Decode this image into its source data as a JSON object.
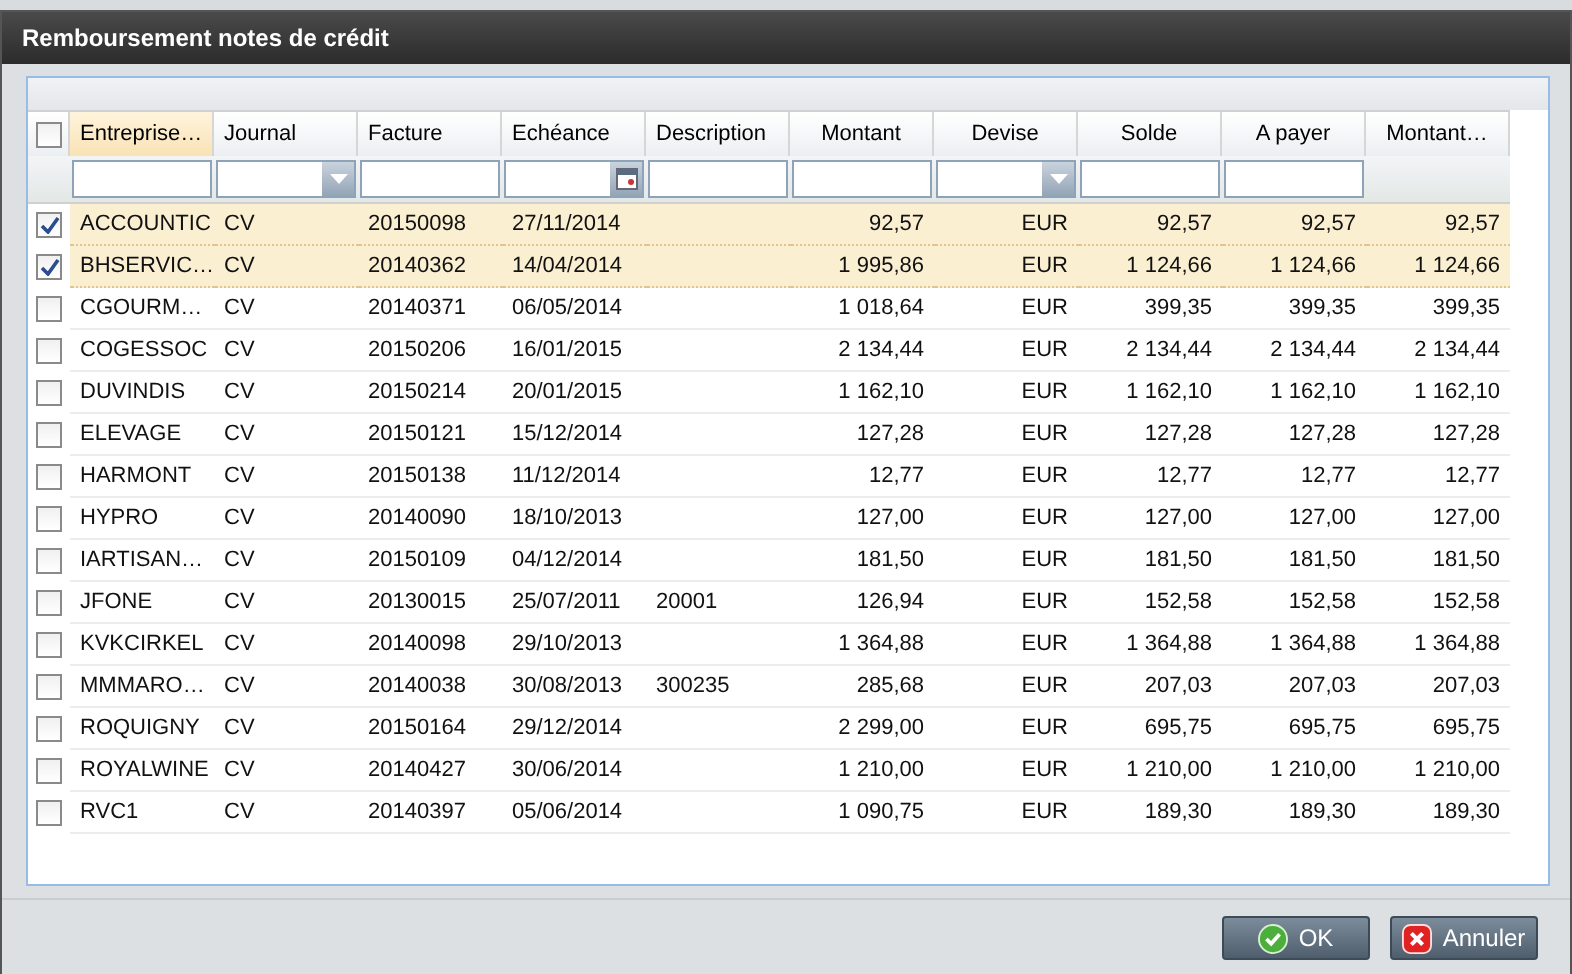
{
  "window": {
    "title": "Remboursement notes de crédit"
  },
  "table": {
    "select_all": {
      "checked": false
    },
    "columns": [
      {
        "label": "Entreprise…",
        "numeric": false,
        "filter": {
          "kind": "text"
        },
        "sorted": true
      },
      {
        "label": "Journal",
        "numeric": false,
        "filter": {
          "kind": "dropdown"
        },
        "sorted": false
      },
      {
        "label": "Facture",
        "numeric": false,
        "filter": {
          "kind": "text"
        },
        "sorted": false
      },
      {
        "label": "Echéance",
        "numeric": false,
        "filter": {
          "kind": "date"
        },
        "sorted": false
      },
      {
        "label": "Description",
        "numeric": false,
        "filter": {
          "kind": "text"
        },
        "sorted": false
      },
      {
        "label": "Montant",
        "numeric": true,
        "filter": {
          "kind": "text"
        },
        "sorted": false
      },
      {
        "label": "Devise",
        "numeric": true,
        "filter": {
          "kind": "dropdown"
        },
        "sorted": false
      },
      {
        "label": "Solde",
        "numeric": true,
        "filter": {
          "kind": "text"
        },
        "sorted": false
      },
      {
        "label": "A payer",
        "numeric": true,
        "filter": {
          "kind": "text"
        },
        "sorted": false
      },
      {
        "label": "Montant…",
        "numeric": true,
        "sorted": false
      }
    ],
    "rows": [
      {
        "checked": true,
        "cells": [
          "ACCOUNTIC",
          "CV",
          "20150098",
          "27/11/2014",
          "",
          "92,57",
          "EUR",
          "92,57",
          "92,57",
          "92,57"
        ]
      },
      {
        "checked": true,
        "cells": [
          "BHSERVIC…",
          "CV",
          "20140362",
          "14/04/2014",
          "",
          "1 995,86",
          "EUR",
          "1 124,66",
          "1 124,66",
          "1 124,66"
        ]
      },
      {
        "checked": false,
        "cells": [
          "CGOURM…",
          "CV",
          "20140371",
          "06/05/2014",
          "",
          "1 018,64",
          "EUR",
          "399,35",
          "399,35",
          "399,35"
        ]
      },
      {
        "checked": false,
        "cells": [
          "COGESSOC",
          "CV",
          "20150206",
          "16/01/2015",
          "",
          "2 134,44",
          "EUR",
          "2 134,44",
          "2 134,44",
          "2 134,44"
        ]
      },
      {
        "checked": false,
        "cells": [
          "DUVINDIS",
          "CV",
          "20150214",
          "20/01/2015",
          "",
          "1 162,10",
          "EUR",
          "1 162,10",
          "1 162,10",
          "1 162,10"
        ]
      },
      {
        "checked": false,
        "cells": [
          "ELEVAGE",
          "CV",
          "20150121",
          "15/12/2014",
          "",
          "127,28",
          "EUR",
          "127,28",
          "127,28",
          "127,28"
        ]
      },
      {
        "checked": false,
        "cells": [
          "HARMONT",
          "CV",
          "20150138",
          "11/12/2014",
          "",
          "12,77",
          "EUR",
          "12,77",
          "12,77",
          "12,77"
        ]
      },
      {
        "checked": false,
        "cells": [
          "HYPRO",
          "CV",
          "20140090",
          "18/10/2013",
          "",
          "127,00",
          "EUR",
          "127,00",
          "127,00",
          "127,00"
        ]
      },
      {
        "checked": false,
        "cells": [
          "IARTISAN…",
          "CV",
          "20150109",
          "04/12/2014",
          "",
          "181,50",
          "EUR",
          "181,50",
          "181,50",
          "181,50"
        ]
      },
      {
        "checked": false,
        "cells": [
          "JFONE",
          "CV",
          "20130015",
          "25/07/2011",
          "20001",
          "126,94",
          "EUR",
          "152,58",
          "152,58",
          "152,58"
        ]
      },
      {
        "checked": false,
        "cells": [
          "KVKCIRKEL",
          "CV",
          "20140098",
          "29/10/2013",
          "",
          "1 364,88",
          "EUR",
          "1 364,88",
          "1 364,88",
          "1 364,88"
        ]
      },
      {
        "checked": false,
        "cells": [
          "MMMARO…",
          "CV",
          "20140038",
          "30/08/2013",
          "300235",
          "285,68",
          "EUR",
          "207,03",
          "207,03",
          "207,03"
        ]
      },
      {
        "checked": false,
        "cells": [
          "ROQUIGNY",
          "CV",
          "20150164",
          "29/12/2014",
          "",
          "2 299,00",
          "EUR",
          "695,75",
          "695,75",
          "695,75"
        ]
      },
      {
        "checked": false,
        "cells": [
          "ROYALWINE",
          "CV",
          "20140427",
          "30/06/2014",
          "",
          "1 210,00",
          "EUR",
          "1 210,00",
          "1 210,00",
          "1 210,00"
        ]
      },
      {
        "checked": false,
        "cells": [
          "RVC1",
          "CV",
          "20140397",
          "05/06/2014",
          "",
          "1 090,75",
          "EUR",
          "189,30",
          "189,30",
          "189,30"
        ]
      }
    ]
  },
  "buttons": [
    {
      "kind": "ok",
      "label": "OK"
    },
    {
      "kind": "cancel",
      "label": "Annuler"
    }
  ]
}
